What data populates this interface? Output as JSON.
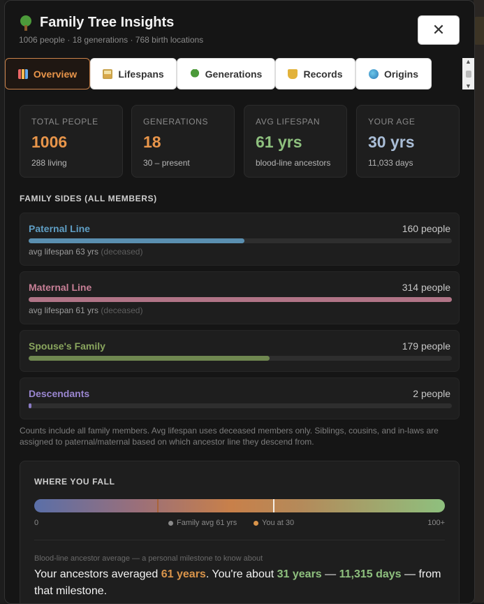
{
  "header": {
    "title": "Family Tree Insights",
    "subtitle": "1006 people · 18 generations · 768 birth locations",
    "close_label": "✕"
  },
  "tabs": [
    {
      "label": "Overview",
      "icon": "chart-icon",
      "active": true
    },
    {
      "label": "Lifespans",
      "icon": "hourglass-icon"
    },
    {
      "label": "Generations",
      "icon": "tree-icon"
    },
    {
      "label": "Records",
      "icon": "trophy-icon"
    },
    {
      "label": "Origins",
      "icon": "globe-icon"
    }
  ],
  "stats": [
    {
      "label": "TOTAL PEOPLE",
      "value": "1006",
      "sub": "288 living",
      "color": "#e8954a"
    },
    {
      "label": "GENERATIONS",
      "value": "18",
      "sub": "30 – present",
      "color": "#e8954a"
    },
    {
      "label": "AVG LIFESPAN",
      "value": "61 yrs",
      "sub": "blood-line ancestors",
      "color": "#8ec07e"
    },
    {
      "label": "YOUR AGE",
      "value": "30 yrs",
      "sub": "11,033 days",
      "color": "#a9bdd6"
    }
  ],
  "family_sides": {
    "label": "FAMILY SIDES (ALL MEMBERS)",
    "items": [
      {
        "name": "Paternal Line",
        "count": "160 people",
        "avg": "avg lifespan 63 yrs",
        "avg_note": "(deceased)",
        "fraction": 0.51,
        "color": "#5f9ec4",
        "bar_color": "#5a8fb0"
      },
      {
        "name": "Maternal Line",
        "count": "314 people",
        "avg": "avg lifespan 61 yrs",
        "avg_note": "(deceased)",
        "fraction": 1.0,
        "color": "#c77f96",
        "bar_color": "#b07486"
      },
      {
        "name": "Spouse's Family",
        "count": "179 people",
        "avg": "",
        "avg_note": "",
        "fraction": 0.57,
        "color": "#8aa65e",
        "bar_color": "#6f8750"
      },
      {
        "name": "Descendants",
        "count": "2 people",
        "avg": "",
        "avg_note": "",
        "fraction": 0.006,
        "color": "#9a86d0",
        "bar_color": "#8a7bc4"
      }
    ],
    "note": "Counts include all family members. Avg lifespan uses deceased members only. Siblings, cousins, and in-laws are assigned to paternal/maternal based on which ancestor line they descend from."
  },
  "where_you_fall": {
    "title": "WHERE YOU FALL",
    "scale_min": "0",
    "scale_max": "100+",
    "family_avg_label": "Family avg 61 yrs",
    "you_label": "You at 30",
    "family_avg_value": 61,
    "you_value": 30,
    "scale_max_value": 100,
    "small": "Blood-line ancestor average — a personal milestone to know about",
    "text_1": "Your ancestors averaged ",
    "hl_1": "61 years",
    "text_2": ". You're about ",
    "hl_2": "31 years",
    "text_3": " — ",
    "hl_3": "11,315 days",
    "text_4": " — from that milestone."
  }
}
